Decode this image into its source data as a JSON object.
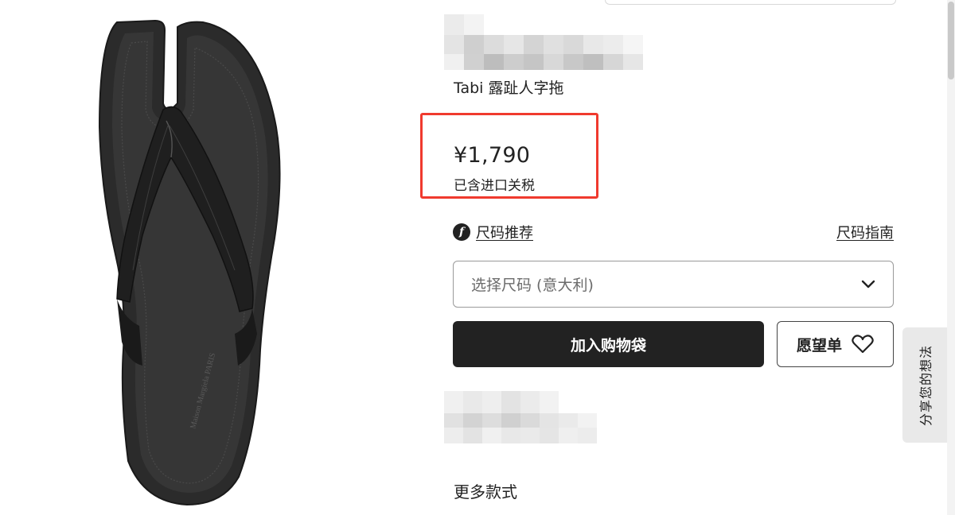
{
  "product": {
    "name": "Tabi 露趾人字拖",
    "price": "¥1,790",
    "tax_note": "已含进口关税",
    "image_alt": "Maison Margiela Tabi thong sandal",
    "sole_engraving": "Maison Margiela PARIS"
  },
  "size": {
    "recommend_label": "尺码推荐",
    "guide_label": "尺码指南",
    "select_placeholder": "选择尺码 (意大利)"
  },
  "actions": {
    "add_to_bag": "加入购物袋",
    "wishlist": "愿望单"
  },
  "sections": {
    "more_styles": "更多款式"
  },
  "feedback": {
    "label": "分享您的想法"
  },
  "colors": {
    "primary_button": "#222222",
    "highlight_border": "#f03a2e",
    "sandal": "#2b2b2b"
  },
  "icons": {
    "size_rec": "f-icon",
    "dropdown": "chevron-down-icon",
    "wishlist": "heart-icon"
  }
}
